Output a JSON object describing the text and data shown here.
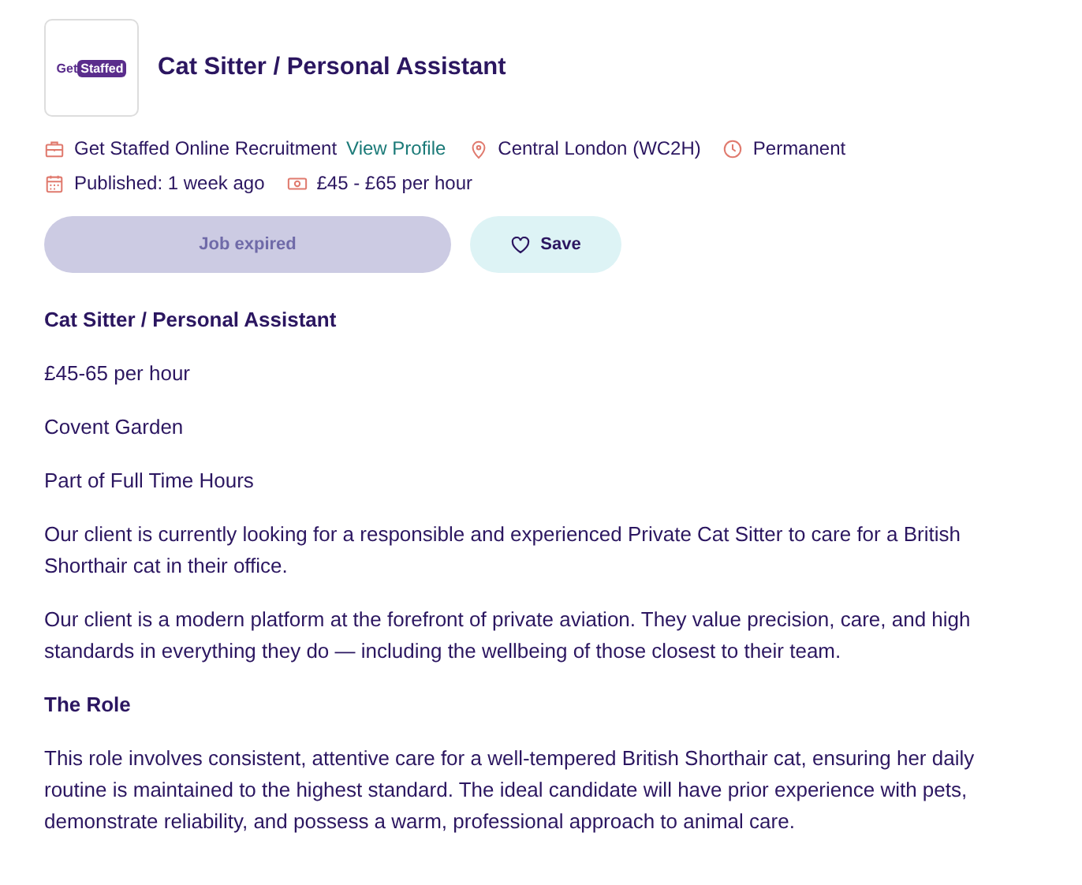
{
  "logo": {
    "prefix": "Get",
    "highlight": "Staffed"
  },
  "title": "Cat Sitter / Personal Assistant",
  "meta": [
    [
      {
        "kind": "company",
        "text": "Get Staffed Online Recruitment",
        "link": "View Profile"
      },
      {
        "kind": "location",
        "text": "Central London (WC2H)"
      },
      {
        "kind": "type",
        "text": "Permanent"
      }
    ],
    [
      {
        "kind": "published",
        "text": "Published: 1 week ago"
      },
      {
        "kind": "salary",
        "text": "£45 - £65 per hour"
      }
    ]
  ],
  "apply_button": {
    "label": "Job expired",
    "disabled": true
  },
  "save_button": {
    "label": "Save"
  },
  "description": [
    {
      "kind": "heading",
      "text": "Cat Sitter / Personal Assistant"
    },
    {
      "kind": "text",
      "text": "£45-65 per hour"
    },
    {
      "kind": "text",
      "text": "Covent Garden"
    },
    {
      "kind": "text",
      "text": "Part of Full Time Hours"
    },
    {
      "kind": "text",
      "text": "Our client is currently looking for a responsible and experienced Private Cat Sitter to care for a British Shorthair cat in their office."
    },
    {
      "kind": "text",
      "text": "Our client is a modern platform at the forefront of private aviation. They value precision, care, and high standards in everything they do — including the wellbeing of those closest to their team."
    },
    {
      "kind": "heading",
      "text": "The Role"
    },
    {
      "kind": "text",
      "text": "This role involves consistent, attentive care for a well-tempered British Shorthair cat, ensuring her daily routine is maintained to the highest standard. The ideal candidate will have prior experience with pets, demonstrate reliability, and possess a warm, professional approach to animal care."
    }
  ]
}
